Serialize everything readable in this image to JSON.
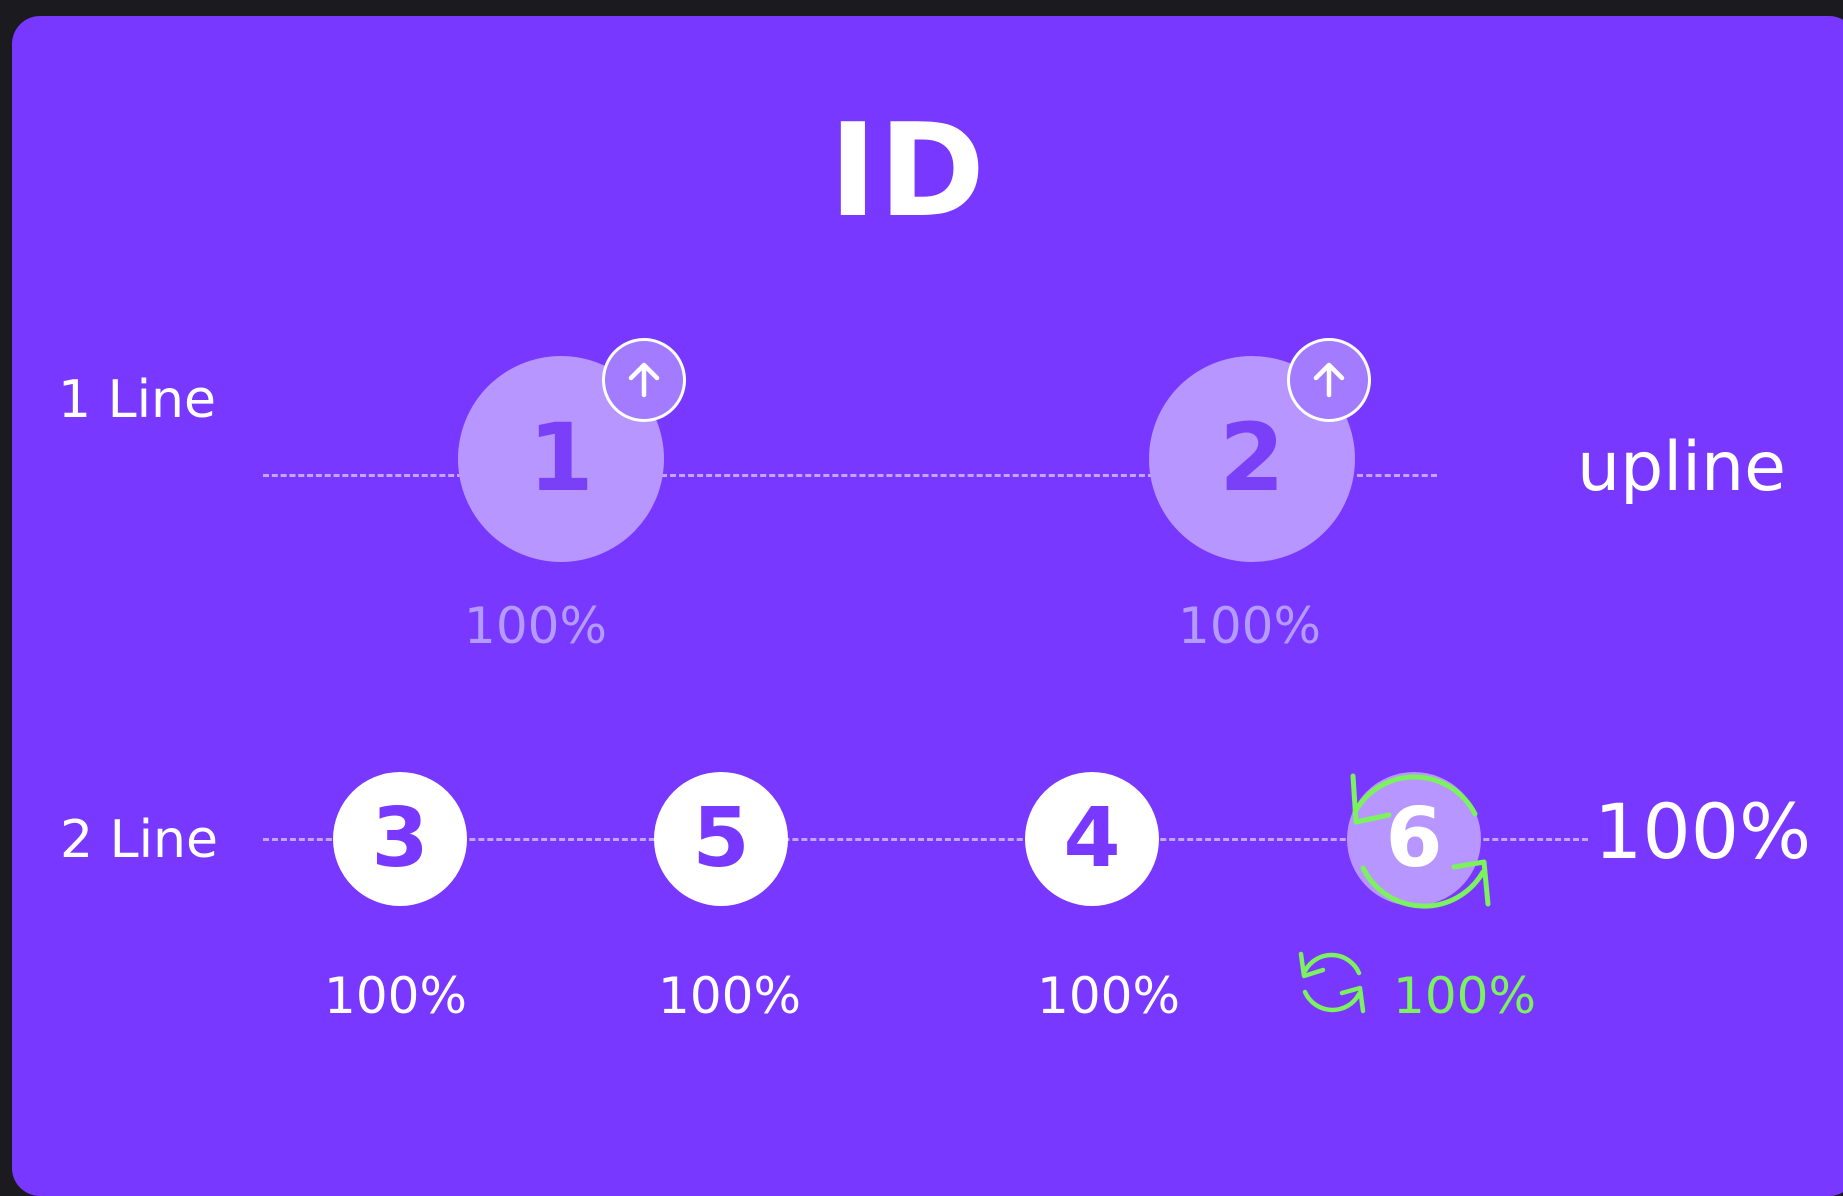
{
  "title": "ID",
  "rows": {
    "line1": {
      "label": "1 Line",
      "side_label": "upline",
      "nodes": [
        {
          "number": "1",
          "percent": "100%",
          "badge_icon": "arrow-up-icon"
        },
        {
          "number": "2",
          "percent": "100%",
          "badge_icon": "arrow-up-icon"
        }
      ]
    },
    "line2": {
      "label": "2 Line",
      "side_value": "100%",
      "nodes": [
        {
          "number": "3",
          "percent": "100%"
        },
        {
          "number": "5",
          "percent": "100%"
        },
        {
          "number": "4",
          "percent": "100%"
        },
        {
          "number": "6",
          "percent": "100%",
          "state_icon": "refresh-cycle-icon"
        }
      ]
    }
  },
  "colors": {
    "background": "#7838ff",
    "node_faded": "#b896ff",
    "node_solid": "#ffffff",
    "accent_green": "#7bf25e"
  }
}
